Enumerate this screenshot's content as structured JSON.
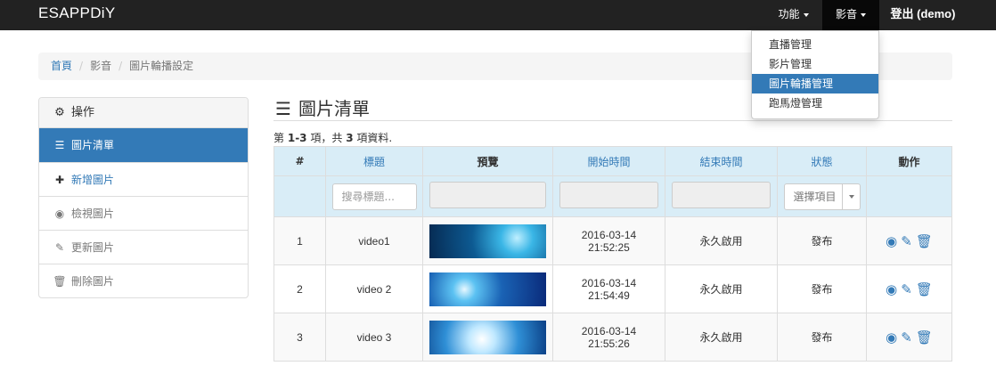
{
  "navbar": {
    "brand": "ESAPPDiY",
    "menu_function": "功能",
    "menu_media": "影音",
    "logout": "登出 (demo)"
  },
  "dropdown": {
    "items": [
      "直播管理",
      "影片管理",
      "圖片輪播管理",
      "跑馬燈管理"
    ],
    "active_index": 2
  },
  "breadcrumb": {
    "home": "首頁",
    "section": "影音",
    "current": "圖片輪播設定"
  },
  "sidebar": {
    "header": "操作",
    "items": [
      {
        "label": "圖片清單",
        "icon": "list-icon",
        "state": "active"
      },
      {
        "label": "新增圖片",
        "icon": "plus-icon",
        "state": "enabled"
      },
      {
        "label": "檢視圖片",
        "icon": "eye-icon",
        "state": "disabled"
      },
      {
        "label": "更新圖片",
        "icon": "pencil-icon",
        "state": "disabled"
      },
      {
        "label": "刪除圖片",
        "icon": "trash-icon",
        "state": "disabled"
      }
    ]
  },
  "main": {
    "title": "圖片清單",
    "summary_prefix": "第",
    "summary_range": "1-3",
    "summary_mid": "項，共",
    "summary_total": "3",
    "summary_suffix": "項資料."
  },
  "table": {
    "columns": [
      "#",
      "標題",
      "預覽",
      "開始時間",
      "結束時間",
      "狀態",
      "動作"
    ],
    "filters": {
      "title_placeholder": "搜尋標題...",
      "status_placeholder": "選擇項目"
    },
    "rows": [
      {
        "num": "1",
        "title": "video1",
        "start_date": "2016-03-14",
        "start_time": "21:52:25",
        "end": "永久啟用",
        "status": "發布"
      },
      {
        "num": "2",
        "title": "video 2",
        "start_date": "2016-03-14",
        "start_time": "21:54:49",
        "end": "永久啟用",
        "status": "發布"
      },
      {
        "num": "3",
        "title": "video 3",
        "start_date": "2016-03-14",
        "start_time": "21:55:26",
        "end": "永久啟用",
        "status": "發布"
      }
    ]
  },
  "colors": {
    "navbar": "#222222",
    "primary": "#337ab7",
    "table_header": "#d9edf7"
  }
}
